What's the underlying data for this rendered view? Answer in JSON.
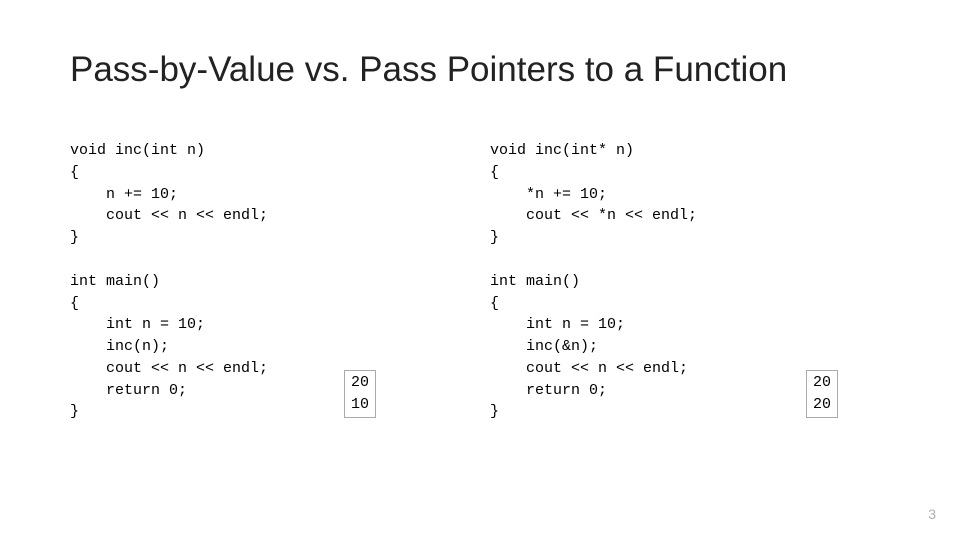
{
  "title": "Pass-by-Value vs. Pass Pointers to a Function",
  "left": {
    "func": "void inc(int n)\n{\n    n += 10;\n    cout << n << endl;\n}",
    "main": "int main()\n{\n    int n = 10;\n    inc(n);\n    cout << n << endl;\n    return 0;\n}",
    "output": "20\n10"
  },
  "right": {
    "func": "void inc(int* n)\n{\n    *n += 10;\n    cout << *n << endl;\n}",
    "main": "int main()\n{\n    int n = 10;\n    inc(&n);\n    cout << n << endl;\n    return 0;\n}",
    "output": "20\n20"
  },
  "page_number": "3"
}
